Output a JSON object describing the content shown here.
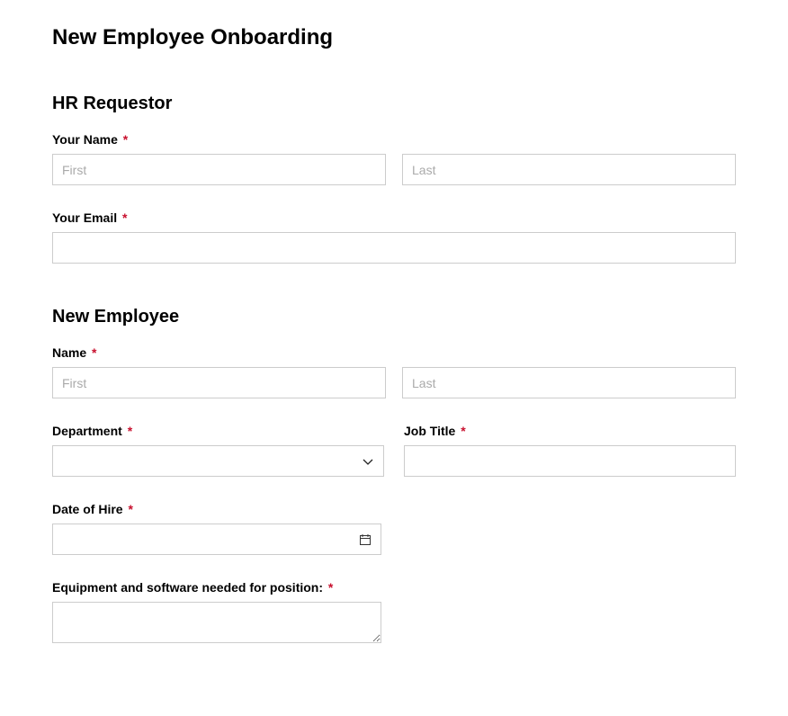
{
  "pageTitle": "New Employee Onboarding",
  "requiredMark": "*",
  "sections": {
    "hrRequestor": {
      "title": "HR Requestor",
      "fields": {
        "yourName": {
          "label": "Your Name",
          "firstPlaceholder": "First",
          "lastPlaceholder": "Last"
        },
        "yourEmail": {
          "label": "Your Email"
        }
      }
    },
    "newEmployee": {
      "title": "New Employee",
      "fields": {
        "name": {
          "label": "Name",
          "firstPlaceholder": "First",
          "lastPlaceholder": "Last"
        },
        "department": {
          "label": "Department"
        },
        "jobTitle": {
          "label": "Job Title"
        },
        "dateOfHire": {
          "label": "Date of Hire"
        },
        "equipment": {
          "label": "Equipment and software needed for position:"
        }
      }
    }
  }
}
